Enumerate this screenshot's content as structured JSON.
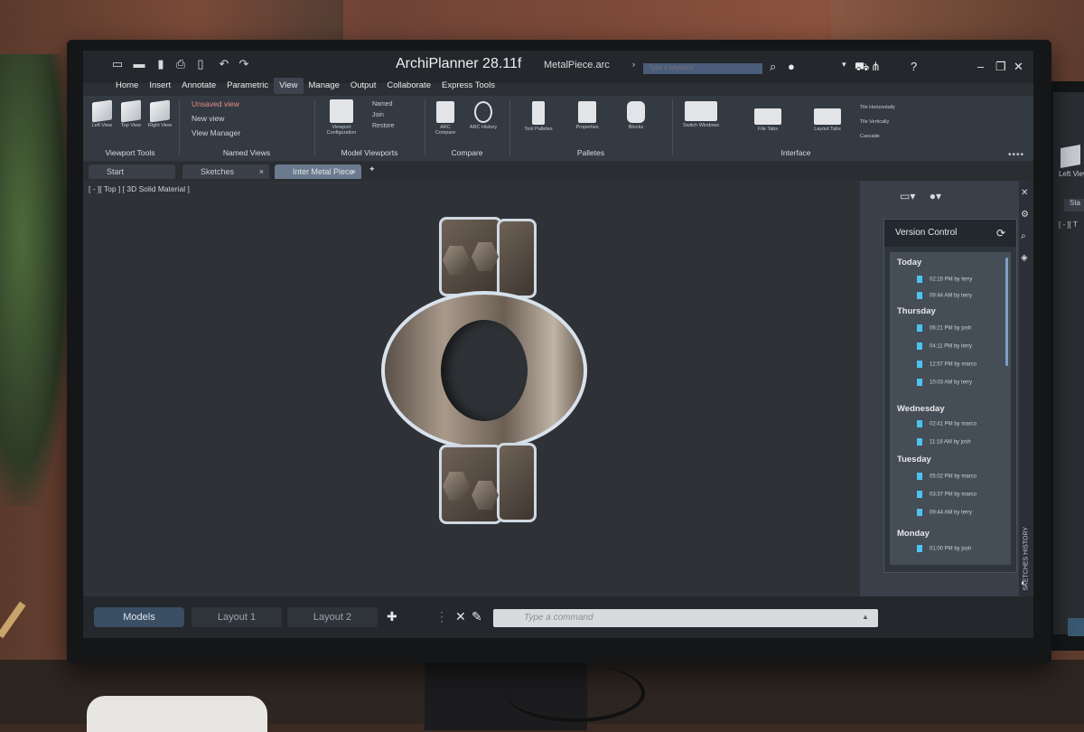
{
  "app": {
    "title": "ArchiPlanner 28.11f",
    "file": "MetalPiece.arc",
    "search_placeholder": "Type a keyword"
  },
  "ribbon_tabs": [
    "Home",
    "Insert",
    "Annotate",
    "Parametric",
    "View",
    "Manage",
    "Output",
    "Collaborate",
    "Express Tools"
  ],
  "active_tab": "View",
  "groups": {
    "viewport_tools": {
      "label": "Viewport Tools",
      "buttons": [
        "Left View",
        "Top View",
        "Right View"
      ]
    },
    "named_views": {
      "label": "Named Views",
      "items": [
        "Unsaved view",
        "New view",
        "View Manager"
      ]
    },
    "model_viewports": {
      "label": "Model Viewports",
      "button": "Viewport Configuration",
      "items": [
        "Named",
        "Join",
        "Restore"
      ]
    },
    "compare": {
      "label": "Compare",
      "buttons": [
        "ARC Compare",
        "ARC History"
      ]
    },
    "palettes": {
      "label": "Palletes",
      "buttons": [
        "Tool Palletes",
        "Properties",
        "Blocks"
      ]
    },
    "interface": {
      "label": "Interface",
      "buttons": [
        "Switch Windows",
        "File Tabs",
        "Layout Tabs"
      ],
      "items": [
        "Tile Horizontally",
        "Tile Vertically",
        "Cascade"
      ]
    }
  },
  "doc_tabs": [
    {
      "label": "Start"
    },
    {
      "label": "Sketches"
    },
    {
      "label": "Inter Metal Piece"
    }
  ],
  "viewport_label": "[ - ][ Top ] [ 3D Solid Material ]",
  "version_control": {
    "title": "Version Control",
    "days": [
      {
        "day": "Today",
        "entries": [
          "02:15 PM by terry",
          "09:44 AM by terry"
        ]
      },
      {
        "day": "Thursday",
        "entries": [
          "06:21 PM by josh",
          "04:11 PM by terry",
          "12:57 PM by marco",
          "10:03 AM by terry"
        ]
      },
      {
        "day": "Wednesday",
        "entries": [
          "02:41 PM by marco",
          "11:18 AM by josh"
        ]
      },
      {
        "day": "Tuesday",
        "entries": [
          "05:02 PM by marco",
          "03:37 PM by marco",
          "09:44 AM by terry"
        ]
      },
      {
        "day": "Monday",
        "entries": [
          "01:00 PM by josh"
        ]
      }
    ]
  },
  "side_label": "SKETCHES HISTORY",
  "bottom_tabs": [
    "Models",
    "Layout 1",
    "Layout 2"
  ],
  "command_placeholder": "Type a command",
  "second_screen": {
    "view_label": "Left View",
    "tab": "Sta",
    "viewport_label": "[ - ][ T"
  }
}
